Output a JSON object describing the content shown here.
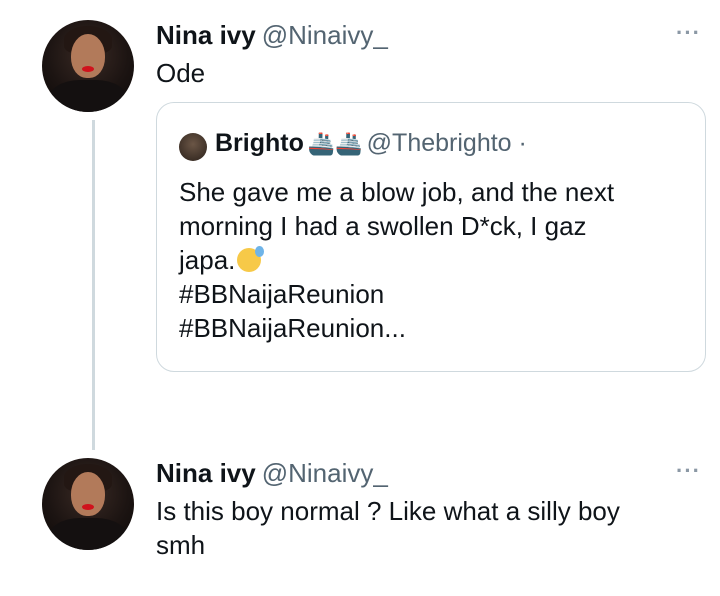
{
  "tweet1": {
    "name": "Nina ivy",
    "handle": "@Ninaivy_",
    "text": "Ode",
    "more": "···"
  },
  "quote": {
    "name": "Brighto",
    "ships": "🚢🚢",
    "handle": "@Thebrighto ·",
    "lines": [
      "She gave me a blow job, and the next",
      "morning I had a swollen D*ck, I gaz",
      "japa.",
      "#BBNaijaReunion",
      "#BBNaijaReunion..."
    ]
  },
  "tweet2": {
    "name": "Nina ivy",
    "handle": "@Ninaivy_",
    "lines": [
      "Is this boy normal ? Like what a silly boy",
      "smh"
    ],
    "more": "···"
  }
}
